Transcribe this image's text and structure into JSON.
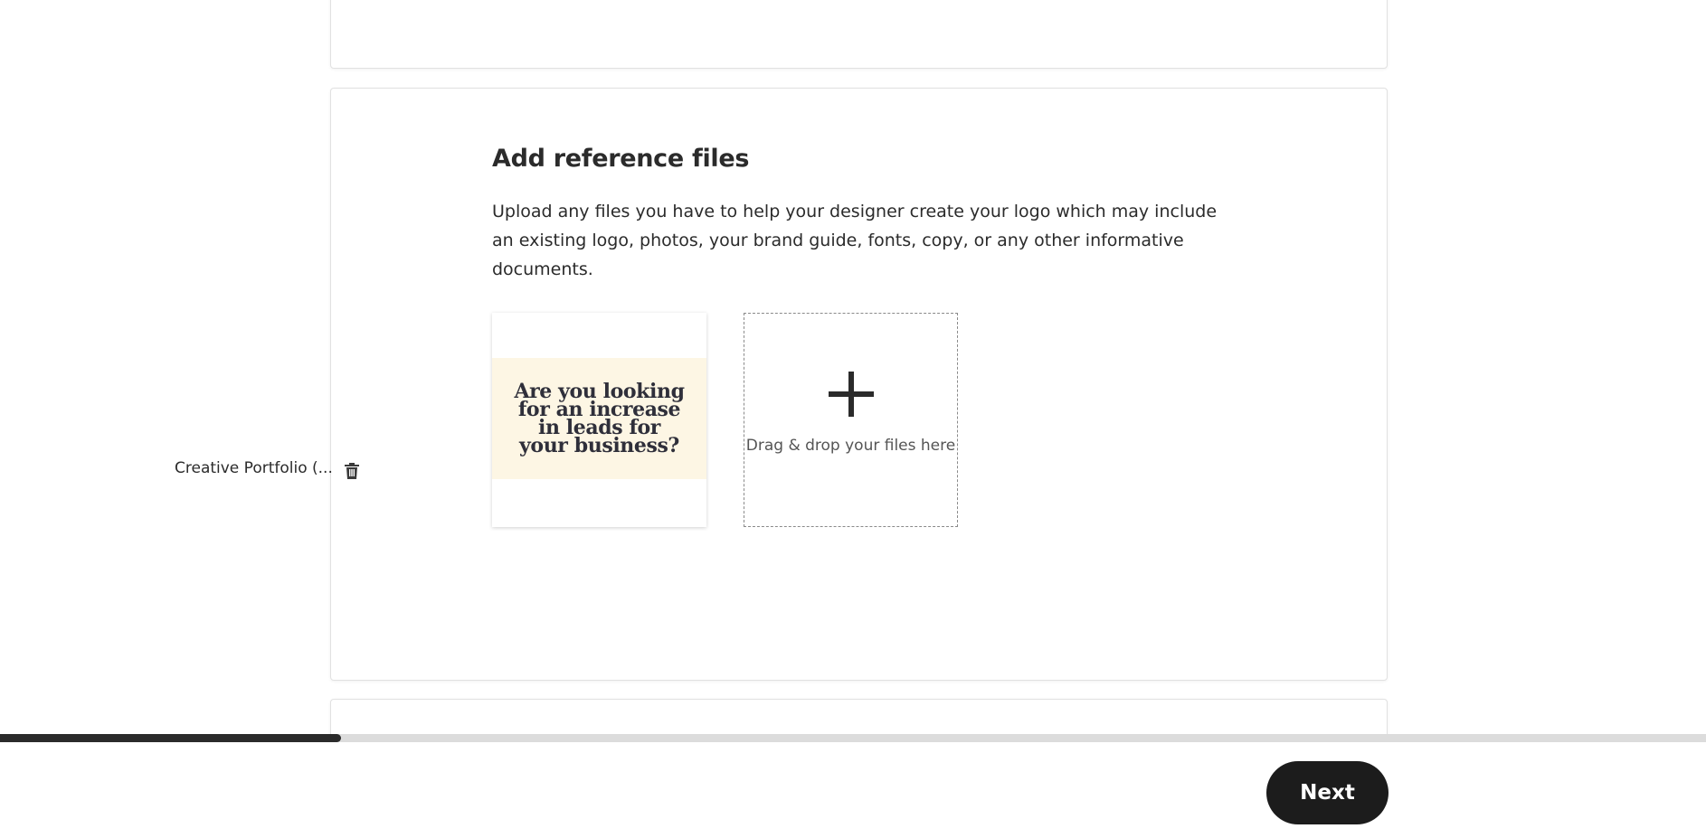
{
  "section": {
    "title": "Add reference files",
    "description": "Upload any files you have to help your designer create your logo which may include an existing logo, photos, your brand guide, fonts, copy, or any other informative documents."
  },
  "uploaded_file": {
    "preview_text": "Are you looking for an increase in leads for your business?",
    "name": "Creative Portfolio (...",
    "delete_icon": "trash-icon"
  },
  "dropzone": {
    "icon": "plus-icon",
    "label": "Drag & drop your files here"
  },
  "progress": {
    "fraction": 0.2
  },
  "footer": {
    "next_label": "Next"
  },
  "colors": {
    "accent": "#1c1c1c",
    "preview_background": "#fdf6e4",
    "progress_track": "#dcdcdc"
  }
}
